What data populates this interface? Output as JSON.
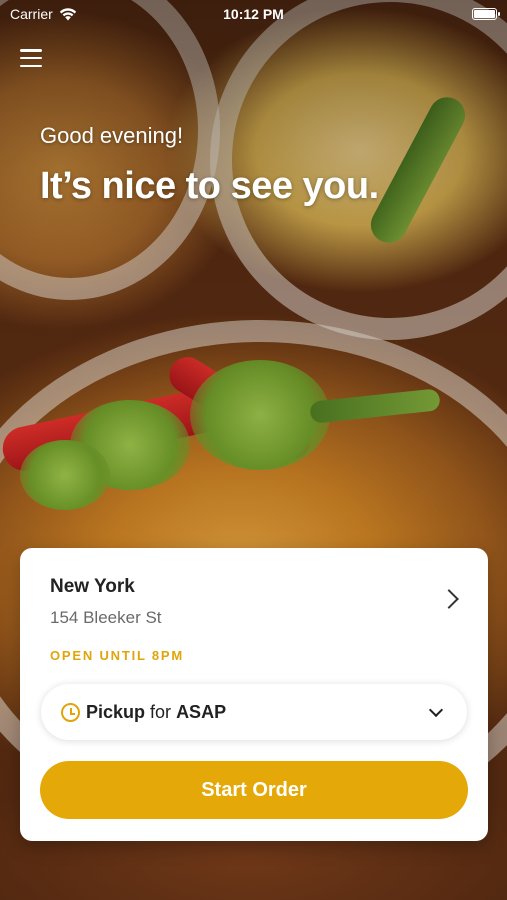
{
  "status_bar": {
    "carrier": "Carrier",
    "time": "10:12 PM",
    "wifi_icon": "wifi-icon",
    "battery_icon": "battery-icon"
  },
  "header": {
    "menu_icon": "hamburger-menu-icon",
    "greeting": "Good evening!",
    "headline": "It’s nice to see you."
  },
  "location_card": {
    "city": "New York",
    "address": "154 Bleeker St",
    "hours": "OPEN UNTIL 8PM",
    "order_mode": "Pickup",
    "for_label": "for",
    "order_time": "ASAP",
    "start_button": "Start Order"
  },
  "colors": {
    "accent": "#e4a908",
    "hours_text": "#e0a50a",
    "card_bg": "#ffffff"
  }
}
